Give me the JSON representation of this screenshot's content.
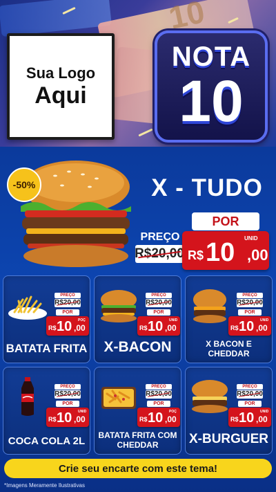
{
  "brand": {
    "logo_line1": "Sua Logo",
    "logo_line2": "Aqui",
    "badge_top": "NOTA",
    "badge_number": "10",
    "bill_number": "10"
  },
  "hero": {
    "discount": "-50%",
    "title": "X - TUDO",
    "por_label": "POR",
    "preco_label": "PREÇO",
    "old_price": "R$20,00",
    "currency": "R$",
    "price_int": "10",
    "price_cents": ",00",
    "unit": "UNID"
  },
  "products": [
    {
      "name": "BATATA FRITA",
      "preco_label": "PREÇO",
      "old_price": "R$20,00",
      "por_label": "POR",
      "currency": "R$",
      "price_int": "10",
      "price_cents": ",00",
      "unit": "POÇ",
      "icon": "fries-icon"
    },
    {
      "name": "X-BACON",
      "preco_label": "PREÇO",
      "old_price": "R$20,00",
      "por_label": "POR",
      "currency": "R$",
      "price_int": "10",
      "price_cents": ",00",
      "unit": "UNID",
      "icon": "burger-icon"
    },
    {
      "name": "X BACON E CHEDDAR",
      "preco_label": "PREÇO",
      "old_price": "R$20,00",
      "por_label": "POR",
      "currency": "R$",
      "price_int": "10",
      "price_cents": ",00",
      "unit": "UNID",
      "icon": "burger-icon"
    },
    {
      "name": "COCA COLA 2L",
      "preco_label": "PREÇO",
      "old_price": "R$20,00",
      "por_label": "POR",
      "currency": "R$",
      "price_int": "10",
      "price_cents": ",00",
      "unit": "UNID",
      "icon": "soda-bottle-icon"
    },
    {
      "name": "BATATA FRITA COM CHEDDAR",
      "preco_label": "PREÇO",
      "old_price": "R$20,00",
      "por_label": "POR",
      "currency": "R$",
      "price_int": "10",
      "price_cents": ",00",
      "unit": "POÇ",
      "icon": "cheese-fries-icon"
    },
    {
      "name": "X-BURGUER",
      "preco_label": "PREÇO",
      "old_price": "R$20,00",
      "por_label": "POR",
      "currency": "R$",
      "price_int": "10",
      "price_cents": ",00",
      "unit": "UNID",
      "icon": "burger-icon"
    }
  ],
  "footer": {
    "cta": "Crie seu encarte com este tema!",
    "disclaimer": "*Imagens Meramente Ilustrativas"
  },
  "colors": {
    "background": "#0b3a9c",
    "price_red": "#d4141c",
    "cta_yellow": "#f8d51c",
    "badge_yellow": "#f6c21b"
  }
}
